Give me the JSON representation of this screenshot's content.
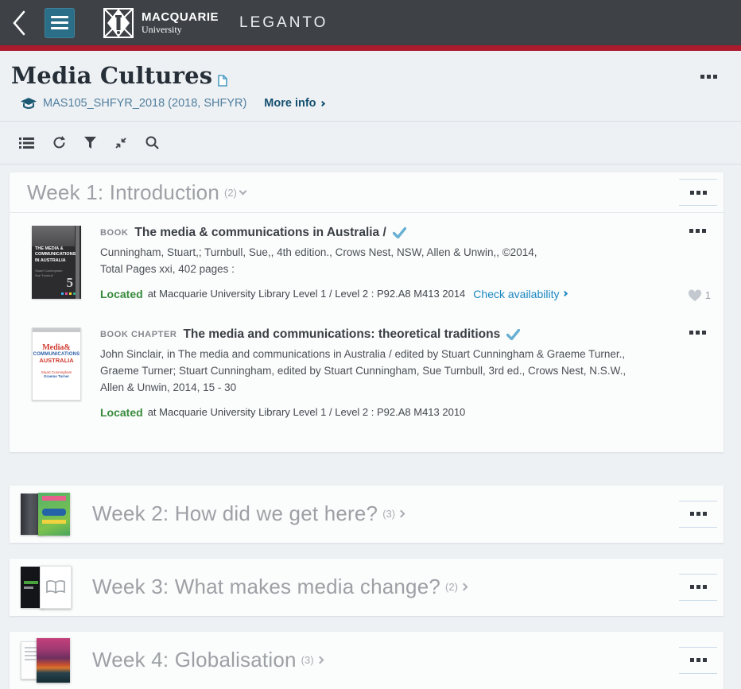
{
  "header": {
    "university_name": "MACQUARIE",
    "university_sub": "University",
    "app_name": "LEGANTO"
  },
  "page": {
    "title": "Media Cultures",
    "course_code": "MAS105_SHFYR_2018 (2018, SHFYR)",
    "more_info_label": "More info"
  },
  "sections": [
    {
      "title": "Week 1: Introduction",
      "count": "(2)",
      "items": [
        {
          "type": "BOOK",
          "title": "The media & communications in Australia /",
          "desc": [
            "Cunningham, Stuart,; Turnbull, Sue,, 4th edition., Crows Nest, NSW, Allen & Unwin,, ©2014,",
            "Total Pages xxi, 402 pages :"
          ],
          "located_label": "Located",
          "located_at": "at Macquarie University Library Level 1 / Level 2 : P92.A8 M413 2014",
          "availability_label": "Check availability",
          "likes_count": "1"
        },
        {
          "type": "BOOK CHAPTER",
          "title": "The media and communications: theoretical traditions",
          "desc": [
            "John Sinclair, in The media and communications in Australia / edited by Stuart Cunningham & Graeme Turner.,",
            "Graeme Turner; Stuart Cunningham, edited by Stuart Cunningham, Sue Turnbull, 3rd ed., Crows Nest, N.S.W.,",
            "Allen & Unwin, 2014, 15 - 30"
          ],
          "located_label": "Located",
          "located_at": "at Macquarie University Library Level 1 / Level 2 : P92.A8 M413 2010"
        }
      ]
    },
    {
      "title": "Week 2: How did we get here?",
      "count": "(3)"
    },
    {
      "title": "Week 3: What makes media change?",
      "count": "(2)"
    },
    {
      "title": "Week 4: Globalisation",
      "count": "(3)"
    }
  ],
  "covers": {
    "book1": {
      "title": "THE MEDIA & COMMUNICATIONS IN AUSTRALIA",
      "edition": "5"
    },
    "book2": {
      "t1": "Media&",
      "t2": "COMMUNICATIONS",
      "t3": "AUSTRALIA"
    }
  },
  "colors": {
    "header_bg": "#3e4247",
    "accent_red": "#ab1a2d",
    "hamburger_teal": "#2b6e88",
    "link_blue": "#1b87c2",
    "located_green": "#378a3c",
    "check_mark_blue": "#68b0d2",
    "page_bg": "#eef1f4"
  }
}
